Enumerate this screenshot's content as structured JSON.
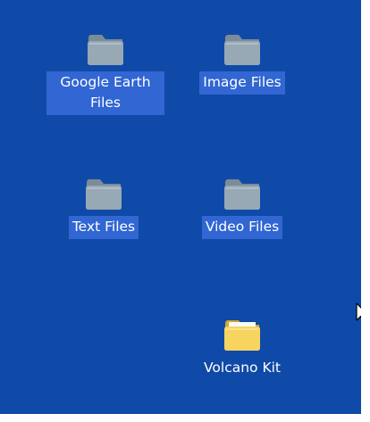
{
  "desktop": {
    "background_color": "#0f4aa8",
    "selection_color": "#3166d3",
    "icons": [
      {
        "label": "Google Earth\nFiles",
        "icon": "folder-icon",
        "style": "faded",
        "selected": true
      },
      {
        "label": "Image Files",
        "icon": "folder-icon",
        "style": "faded",
        "selected": true
      },
      {
        "label": "Text Files",
        "icon": "folder-icon",
        "style": "faded",
        "selected": true
      },
      {
        "label": "Video Files",
        "icon": "folder-icon",
        "style": "faded",
        "selected": true
      },
      {
        "label": "Volcano Kit",
        "icon": "folder-icon",
        "style": "normal",
        "selected": false
      }
    ]
  },
  "cursor": {
    "icon": "mouse-pointer-icon"
  }
}
